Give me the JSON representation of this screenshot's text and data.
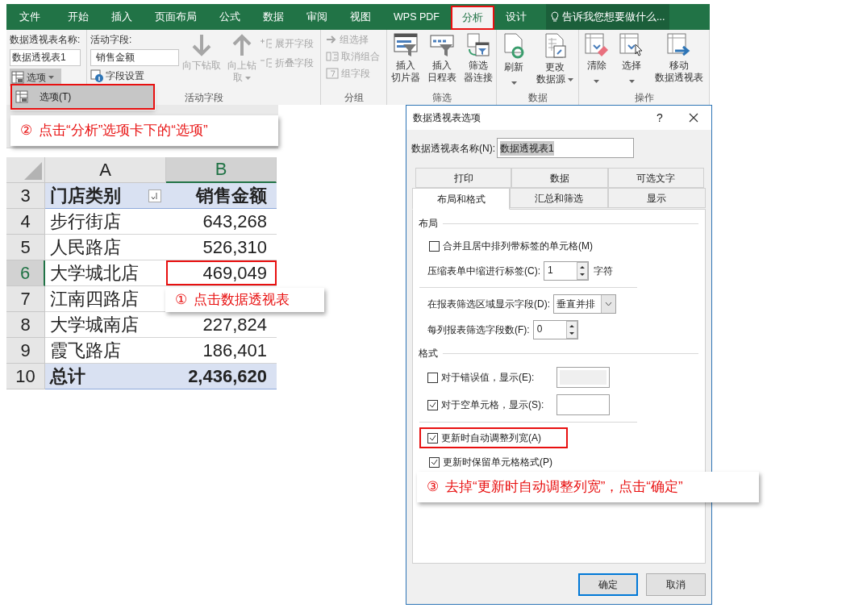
{
  "ribbon": {
    "tabs": [
      {
        "label": "文件",
        "selected": false
      },
      {
        "label": "开始",
        "selected": false
      },
      {
        "label": "插入",
        "selected": false
      },
      {
        "label": "页面布局",
        "selected": false
      },
      {
        "label": "公式",
        "selected": false
      },
      {
        "label": "数据",
        "selected": false
      },
      {
        "label": "审阅",
        "selected": false
      },
      {
        "label": "视图",
        "selected": false
      },
      {
        "label": "WPS PDF",
        "selected": false
      },
      {
        "label": "分析",
        "selected": true
      },
      {
        "label": "设计",
        "selected": false
      }
    ],
    "tell_me": "告诉我您想要做什么...",
    "pivot_table_group": {
      "name_label": "数据透视表名称:",
      "name_value": "数据透视表1",
      "options_button": "选项"
    },
    "active_field_group": {
      "field_label": "活动字段:",
      "field_value": "销售金额",
      "field_settings": "字段设置",
      "drill_buttons": [
        {
          "kind": "down",
          "lines": [
            "向下钻取"
          ],
          "disabled": true
        },
        {
          "kind": "up",
          "lines": [
            "向上钻",
            "取"
          ],
          "dropdown": true,
          "disabled": true
        }
      ],
      "expand_buttons": [
        {
          "kind": "expand",
          "label": "展开字段",
          "disabled": true
        },
        {
          "kind": "collapse",
          "label": "折叠字段",
          "disabled": true
        }
      ],
      "caption": "活动字段"
    },
    "group_group": {
      "buttons": [
        {
          "kind": "group_selection",
          "label": "组选择",
          "disabled": true
        },
        {
          "kind": "ungroup",
          "label": "取消组合",
          "disabled": true
        },
        {
          "kind": "group_field",
          "label": "组字段",
          "disabled": true
        }
      ],
      "caption": "分组"
    },
    "filter_group": {
      "buttons": [
        {
          "kind": "slicer",
          "lines": [
            "插入",
            "切片器"
          ]
        },
        {
          "kind": "timeline",
          "lines": [
            "插入",
            "日程表"
          ]
        },
        {
          "kind": "connections",
          "lines": [
            "筛选",
            "器连接"
          ]
        }
      ],
      "caption": "筛选"
    },
    "data_group": {
      "buttons": [
        {
          "kind": "refresh",
          "lines": [
            "刷新"
          ],
          "dropdown": true
        },
        {
          "kind": "change_source",
          "lines": [
            "更改",
            "数据源"
          ],
          "dropdown": true
        }
      ],
      "caption": "数据"
    },
    "actions_group": {
      "buttons": [
        {
          "kind": "clear",
          "lines": [
            "清除"
          ],
          "dropdown": true
        },
        {
          "kind": "select",
          "lines": [
            "选择"
          ],
          "dropdown": true
        },
        {
          "kind": "move",
          "lines": [
            "移动",
            "数据透视表"
          ]
        }
      ],
      "caption": "操作"
    }
  },
  "options_menu": {
    "items": [
      {
        "label": "选项(T)",
        "selected": true
      }
    ]
  },
  "spreadsheet": {
    "columns": [
      {
        "label": "A",
        "selected": false
      },
      {
        "label": "B",
        "selected": true
      }
    ],
    "rows": [
      {
        "number": "3",
        "kind": "header",
        "selected": false,
        "cells": [
          "门店类别",
          "销售金额"
        ]
      },
      {
        "number": "4",
        "kind": "data",
        "selected": false,
        "cells": [
          "步行街店",
          "643,268"
        ]
      },
      {
        "number": "5",
        "kind": "data",
        "selected": false,
        "cells": [
          "人民路店",
          "526,310"
        ]
      },
      {
        "number": "6",
        "kind": "data",
        "selected": true,
        "cells": [
          "大学城北店",
          "469,049"
        ]
      },
      {
        "number": "7",
        "kind": "data",
        "selected": false,
        "cells": [
          "江南四路店"
        ]
      },
      {
        "number": "8",
        "kind": "data",
        "selected": false,
        "cells": [
          "大学城南店",
          "227,824"
        ]
      },
      {
        "number": "9",
        "kind": "data",
        "selected": false,
        "cells": [
          "霞飞路店",
          "186,401"
        ]
      },
      {
        "number": "10",
        "kind": "total",
        "selected": false,
        "cells": [
          "总计",
          "2,436,620"
        ]
      }
    ]
  },
  "dialog": {
    "title": "数据透视表选项",
    "help": "?",
    "name_label": "数据透视表名称(N):",
    "name_value": "数据透视表1",
    "tabs_back": [
      {
        "label": "打印",
        "selected": false
      },
      {
        "label": "数据",
        "selected": false
      },
      {
        "label": "可选文字",
        "selected": false
      }
    ],
    "tabs_front": [
      {
        "label": "布局和格式",
        "selected": true
      },
      {
        "label": "汇总和筛选",
        "selected": false
      },
      {
        "label": "显示",
        "selected": false
      }
    ],
    "sections": [
      {
        "title": "布局",
        "controls": [
          {
            "kind": "checkbox",
            "label": "合并且居中排列带标签的单元格(M)",
            "checked": false
          },
          {
            "kind": "spinner",
            "label": "压缩表单中缩进行标签(C):",
            "value": "1",
            "suffix": "字符"
          },
          {
            "kind": "divider"
          },
          {
            "kind": "dropdown",
            "label": "在报表筛选区域显示字段(D):",
            "value": "垂直并排"
          },
          {
            "kind": "spinner",
            "label": "每列报表筛选字段数(F):",
            "value": "0"
          }
        ]
      },
      {
        "title": "格式",
        "controls": [
          {
            "kind": "checkbox_field",
            "label": "对于错误值，显示(E):",
            "checked": false
          },
          {
            "kind": "checkbox_field",
            "label": "对于空单元格，显示(S):",
            "checked": true
          },
          {
            "kind": "divider"
          },
          {
            "kind": "checkbox",
            "label": "更新时自动调整列宽(A)",
            "checked": true,
            "highlighted": true
          },
          {
            "kind": "checkbox",
            "label": "更新时保留单元格格式(P)",
            "checked": true
          }
        ]
      }
    ],
    "buttons": [
      {
        "label": "确定",
        "default": true
      },
      {
        "label": "取消",
        "default": false
      }
    ]
  },
  "callouts": [
    {
      "number": "②",
      "text": "点击“分析”选项卡下的“选项”"
    },
    {
      "number": "①",
      "text": "点击数据透视表"
    },
    {
      "number": "③",
      "text": "去掉“更新时自动调整列宽”，点击“确定”"
    }
  ]
}
